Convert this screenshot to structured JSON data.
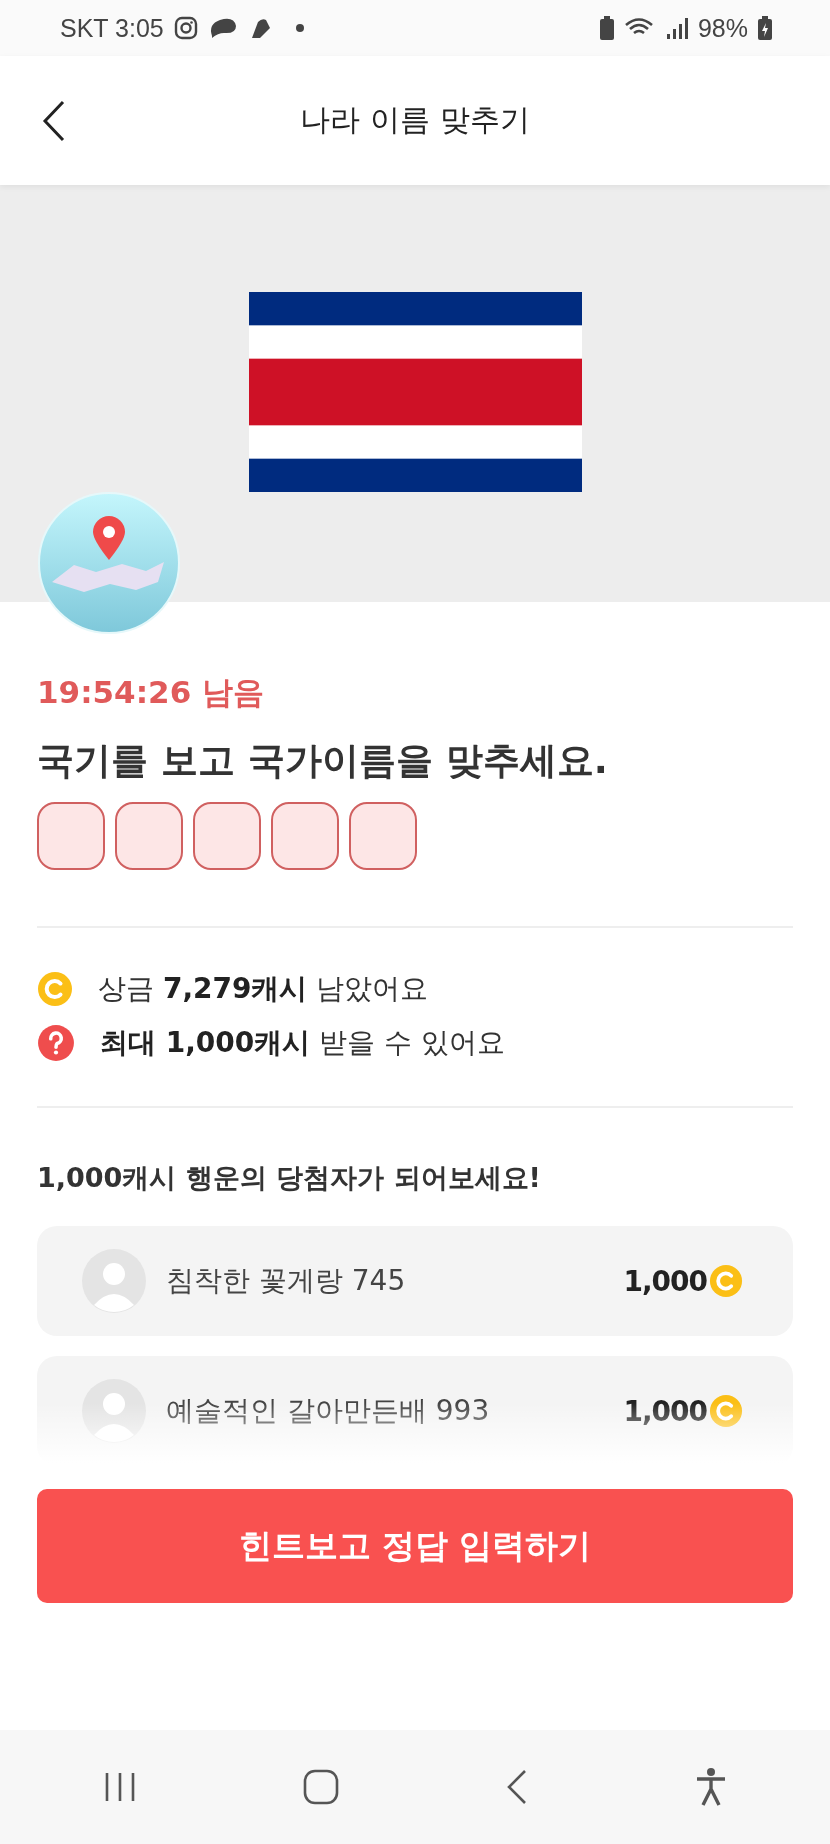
{
  "status_bar": {
    "carrier_time": "SKT 3:05",
    "battery": "98%"
  },
  "header": {
    "title": "나라 이름 맞추기"
  },
  "quiz": {
    "timer": "19:54:26 남음",
    "question": "국기를 보고 국가이름을 맞추세요.",
    "answer_slots": [
      {
        "filled": false
      },
      {
        "filled": false
      },
      {
        "filled": false
      },
      {
        "filled": false
      },
      {
        "filled": false
      }
    ]
  },
  "info": [
    {
      "kind": "coin",
      "text": "상금 **7,279캐시** 남았어요"
    },
    {
      "kind": "question",
      "text": "**최대 1,000캐시** 받을 수 있어요"
    }
  ],
  "winners": {
    "heading": "1,000캐시 행운의 당첨자가 되어보세요!",
    "rows": [
      {
        "name": "침착한 꽃게랑 745",
        "amount": "1,000"
      },
      {
        "name": "예술적인 갈아만든배 993",
        "amount": "1,000"
      }
    ]
  },
  "cta_button": "힌트보고 정답 입력하기"
}
